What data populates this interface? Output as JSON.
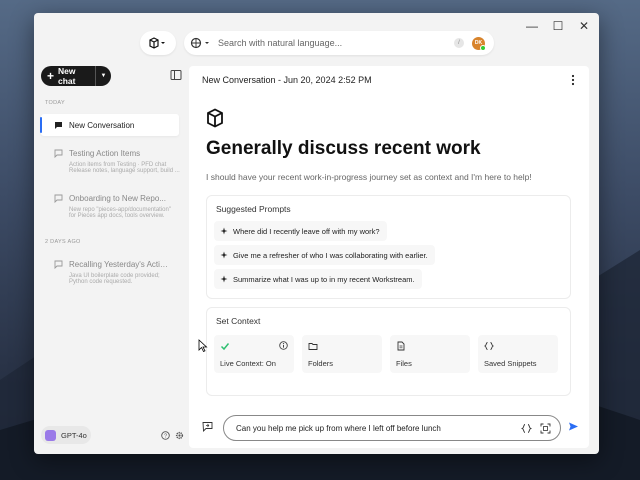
{
  "window": {
    "controls": {
      "minimize": "—",
      "maximize": "☐",
      "close": "✕"
    }
  },
  "search": {
    "placeholder": "Search with natural language...",
    "shortcut": "/",
    "avatar_initials": "DK"
  },
  "sidebar": {
    "new_chat_label": "New chat",
    "today_label": "TODAY",
    "earlier_label": "2 DAYS AGO",
    "items": [
      {
        "title": "New Conversation",
        "subtitle": []
      },
      {
        "title": "Testing Action Items",
        "subtitle": [
          "Action items from Testing · PFD chat",
          "Release notes, language support, build ..."
        ]
      },
      {
        "title": "Onboarding to New Repo...",
        "subtitle": [
          "New repo \"pieces-app/documentation\"",
          "for Pieces app docs, tools overview."
        ]
      },
      {
        "title": "Recalling Yesterday's Activ...",
        "subtitle": [
          "Java UI boilerplate code provided;",
          "Python code requested."
        ]
      }
    ],
    "model_label": "GPT-4o"
  },
  "main": {
    "conversation_header": "New Conversation - Jun 20, 2024 2:52 PM",
    "title": "Generally discuss recent work",
    "subtitle": "I should have your recent work-in-progress journey set as context and I'm here to help!",
    "suggested_title": "Suggested Prompts",
    "prompts": [
      "Where did I recently leave off with my work?",
      "Give me a refresher of who I was collaborating with earlier.",
      "Summarize what I was up to in my recent Workstream."
    ],
    "context_title": "Set Context",
    "context_tiles": [
      {
        "label": "Live Context: On",
        "icon": "check-icon"
      },
      {
        "label": "Folders",
        "icon": "folder-icon"
      },
      {
        "label": "Files",
        "icon": "file-icon"
      },
      {
        "label": "Saved Snippets",
        "icon": "code-braces-icon"
      }
    ],
    "chat_input_value": "Can you help me pick up from where I left off before lunch"
  },
  "colors": {
    "accent": "#2a6df4",
    "check": "#2fbf71",
    "send": "#2a6df4"
  }
}
